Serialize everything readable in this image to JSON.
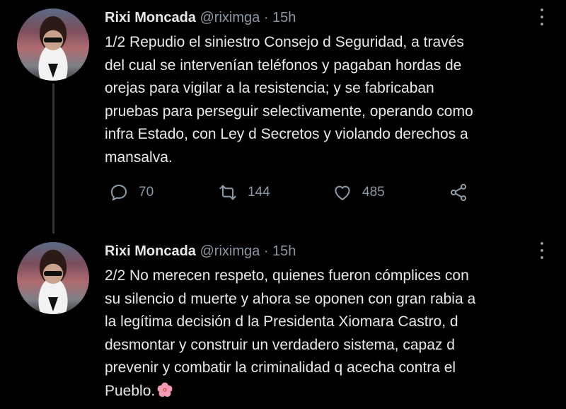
{
  "tweets": [
    {
      "author_name": "Rixi Moncada",
      "handle": "@riximga",
      "separator": "·",
      "time": "15h",
      "text": "1/2 Repudio el siniestro Consejo d Seguridad, a través\ndel cual se intervenían teléfonos y pagaban hordas de\norejas para vigilar a la resistencia; y se fabricaban\npruebas para perseguir selectivamente, operando como\ninfra Estado, con Ley d Secretos y violando derechos a\nmansalva.",
      "replies": "70",
      "retweets": "144",
      "likes": "485"
    },
    {
      "author_name": "Rixi Moncada",
      "handle": "@riximga",
      "separator": "·",
      "time": "15h",
      "text": "2/2 No merecen respeto, quienes fueron cómplices con\nsu silencio d muerte y ahora se oponen con gran rabia a\nla legítima decisión d la Presidenta Xiomara Castro, d\ndesmontar y construir un verdadero sistema, capaz d\nprevenir y combatir la criminalidad q acecha contra el\nPueblo.",
      "emoji": "hibiscus-flower-emoji"
    }
  ],
  "colors": {
    "background": "#000000",
    "text": "#e7e9ea",
    "secondary": "#8b98a5",
    "thread_line": "#333639"
  }
}
